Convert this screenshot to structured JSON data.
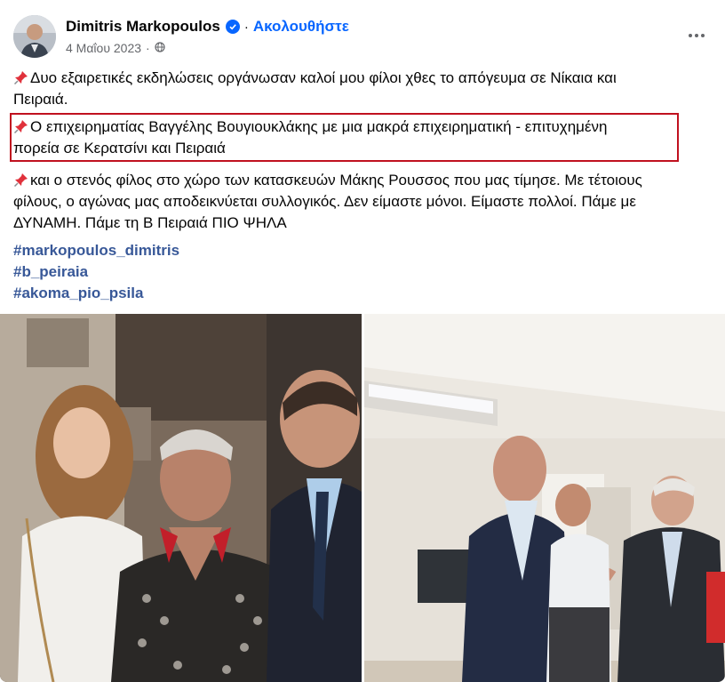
{
  "post": {
    "author": "Dimitris Markopoulos",
    "follow_label": "Ακολουθήστε",
    "date": "4 Μαΐου 2023",
    "separator": "·",
    "audience_icon": "globe-icon",
    "more_icon": "more-options-icon",
    "paragraphs": {
      "p1": "Δυο εξαιρετικές εκδηλώσεις οργάνωσαν καλοί μου φίλοι χθες το απόγευμα σε Νίκαια και",
      "p1b": "Πειραιά.",
      "p2": "Ο επιχειρηματίας Βαγγέλης Βουγιουκλάκης με μια μακρά επιχειρηματική - επιτυχημένη",
      "p2b": "πορεία σε Κερατσίνι και Πειραιά",
      "p3": "και ο στενός φίλος στο χώρο των κατασκευών Μάκης Ρουσσος που μας τίμησε. Με τέτοιους",
      "p3b": "φίλους, ο αγώνας μας αποδεικνύεται συλλογικός. Δεν είμαστε μόνοι. Είμαστε πολλοί. Πάμε με",
      "p3c": "ΔΥΝΑΜΗ. Πάμε τη Β Πειραιά ΠΙΟ ΨΗΛΑ"
    },
    "hashtags": [
      "#markopoulos_dimitris",
      "#b_peiraia",
      "#akoma_pio_psila"
    ]
  },
  "colors": {
    "link_blue": "#0866ff",
    "hashtag_blue": "#385898",
    "highlight_red": "#c0111f",
    "meta_gray": "#65676b"
  }
}
